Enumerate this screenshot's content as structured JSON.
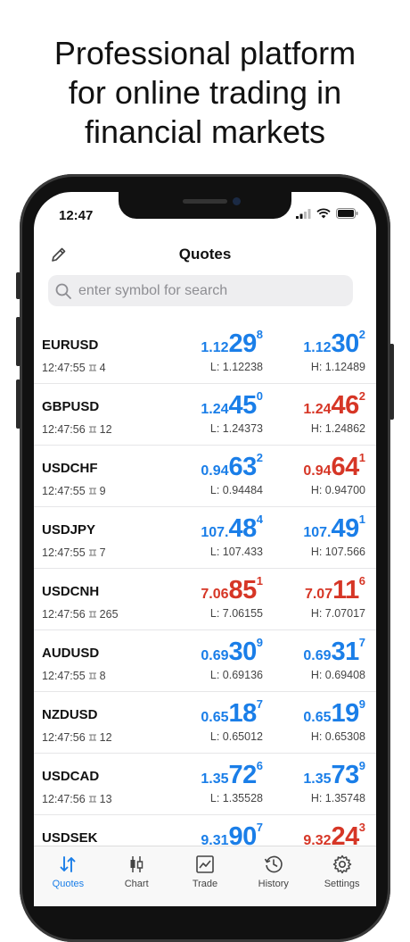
{
  "headline": {
    "line1": "Professional platform",
    "line2": "for online trading in",
    "line3": "financial markets"
  },
  "status": {
    "time": "12:47"
  },
  "nav": {
    "title": "Quotes"
  },
  "search": {
    "placeholder": "enter symbol for search"
  },
  "colors": {
    "up": "#1a7ee8",
    "down": "#d63626"
  },
  "quotes": [
    {
      "symbol": "EURUSD",
      "time": "12:47:55",
      "spread": "4",
      "bid": {
        "small": "1.12",
        "big": "29",
        "sup": "8",
        "dir": "up"
      },
      "ask": {
        "small": "1.12",
        "big": "30",
        "sup": "2",
        "dir": "up"
      },
      "low": "L: 1.12238",
      "high": "H: 1.12489"
    },
    {
      "symbol": "GBPUSD",
      "time": "12:47:56",
      "spread": "12",
      "bid": {
        "small": "1.24",
        "big": "45",
        "sup": "0",
        "dir": "up"
      },
      "ask": {
        "small": "1.24",
        "big": "46",
        "sup": "2",
        "dir": "down"
      },
      "low": "L: 1.24373",
      "high": "H: 1.24862"
    },
    {
      "symbol": "USDCHF",
      "time": "12:47:55",
      "spread": "9",
      "bid": {
        "small": "0.94",
        "big": "63",
        "sup": "2",
        "dir": "up"
      },
      "ask": {
        "small": "0.94",
        "big": "64",
        "sup": "1",
        "dir": "down"
      },
      "low": "L: 0.94484",
      "high": "H: 0.94700"
    },
    {
      "symbol": "USDJPY",
      "time": "12:47:55",
      "spread": "7",
      "bid": {
        "small": "107.",
        "big": "48",
        "sup": "4",
        "dir": "up"
      },
      "ask": {
        "small": "107.",
        "big": "49",
        "sup": "1",
        "dir": "up"
      },
      "low": "L: 107.433",
      "high": "H: 107.566"
    },
    {
      "symbol": "USDCNH",
      "time": "12:47:56",
      "spread": "265",
      "bid": {
        "small": "7.06",
        "big": "85",
        "sup": "1",
        "dir": "down"
      },
      "ask": {
        "small": "7.07",
        "big": "11",
        "sup": "6",
        "dir": "down"
      },
      "low": "L: 7.06155",
      "high": "H: 7.07017"
    },
    {
      "symbol": "AUDUSD",
      "time": "12:47:55",
      "spread": "8",
      "bid": {
        "small": "0.69",
        "big": "30",
        "sup": "9",
        "dir": "up"
      },
      "ask": {
        "small": "0.69",
        "big": "31",
        "sup": "7",
        "dir": "up"
      },
      "low": "L: 0.69136",
      "high": "H: 0.69408"
    },
    {
      "symbol": "NZDUSD",
      "time": "12:47:56",
      "spread": "12",
      "bid": {
        "small": "0.65",
        "big": "18",
        "sup": "7",
        "dir": "up"
      },
      "ask": {
        "small": "0.65",
        "big": "19",
        "sup": "9",
        "dir": "up"
      },
      "low": "L: 0.65012",
      "high": "H: 0.65308"
    },
    {
      "symbol": "USDCAD",
      "time": "12:47:56",
      "spread": "13",
      "bid": {
        "small": "1.35",
        "big": "72",
        "sup": "6",
        "dir": "up"
      },
      "ask": {
        "small": "1.35",
        "big": "73",
        "sup": "9",
        "dir": "up"
      },
      "low": "L: 1.35528",
      "high": "H: 1.35748"
    },
    {
      "symbol": "USDSEK",
      "time": "",
      "spread": "",
      "bid": {
        "small": "9.31",
        "big": "90",
        "sup": "7",
        "dir": "up"
      },
      "ask": {
        "small": "9.32",
        "big": "24",
        "sup": "3",
        "dir": "down"
      },
      "low": "",
      "high": ""
    }
  ],
  "tabs": [
    {
      "label": "Quotes",
      "icon": "quotes-arrows-icon",
      "active": true
    },
    {
      "label": "Chart",
      "icon": "candlestick-chart-icon",
      "active": false
    },
    {
      "label": "Trade",
      "icon": "trade-chart-icon",
      "active": false
    },
    {
      "label": "History",
      "icon": "history-clock-icon",
      "active": false
    },
    {
      "label": "Settings",
      "icon": "gear-icon",
      "active": false
    }
  ]
}
